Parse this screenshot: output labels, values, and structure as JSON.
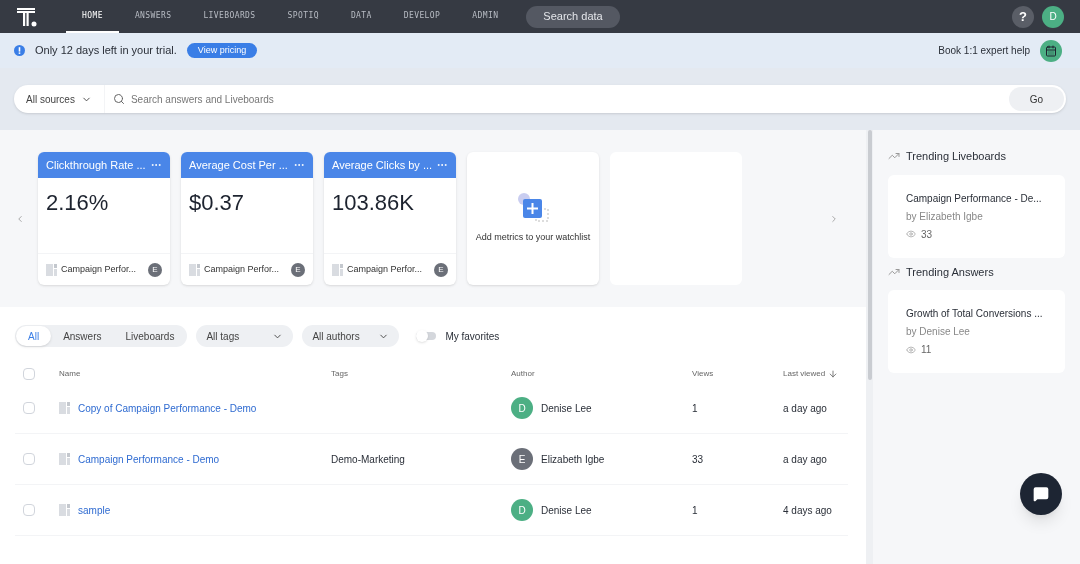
{
  "nav": {
    "items": [
      {
        "label": "HOME",
        "selected": true
      },
      {
        "label": "ANSWERS",
        "selected": false
      },
      {
        "label": "LIVEBOARDS",
        "selected": false
      },
      {
        "label": "SPOTIQ",
        "selected": false
      },
      {
        "label": "DATA",
        "selected": false
      },
      {
        "label": "DEVELOP",
        "selected": false
      },
      {
        "label": "ADMIN",
        "selected": false
      }
    ],
    "search_button": "Search data",
    "help": "?",
    "avatar": "D"
  },
  "banner": {
    "message": "Only 12 days left in your trial.",
    "button": "View pricing",
    "help_text": "Book 1:1 expert help"
  },
  "search": {
    "source": "All sources",
    "placeholder": "Search answers and Liveboards",
    "button": "Go"
  },
  "watchlist": {
    "cards": [
      {
        "kind": "metric",
        "title": "Clickthrough Rate ...",
        "value": "2.16%",
        "source": "Campaign Perfor...",
        "author": "E"
      },
      {
        "kind": "metric",
        "title": "Average Cost Per ...",
        "value": "$0.37",
        "source": "Campaign Perfor...",
        "author": "E"
      },
      {
        "kind": "metric",
        "title": "Average Clicks by ...",
        "value": "103.86K",
        "source": "Campaign Perfor...",
        "author": "E"
      },
      {
        "kind": "add",
        "label": "Add metrics to your watchlist"
      },
      {
        "kind": "empty"
      }
    ]
  },
  "filters": {
    "segments": [
      {
        "label": "All",
        "selected": true
      },
      {
        "label": "Answers",
        "selected": false
      },
      {
        "label": "Liveboards",
        "selected": false
      }
    ],
    "dropdowns": [
      "All tags",
      "All authors"
    ],
    "favorites": {
      "label": "My favorites",
      "on": false
    }
  },
  "table": {
    "select_all_checked": false,
    "columns": [
      "Name",
      "Tags",
      "Author",
      "Views",
      "Last viewed"
    ],
    "rows": [
      {
        "checked": false,
        "name": "Copy of Campaign Performance - Demo",
        "tags": "",
        "author": "Denise Lee",
        "initial": "D",
        "color": "#4caf84",
        "views": "1",
        "last_viewed": "a day ago"
      },
      {
        "checked": false,
        "name": "Campaign Performance - Demo",
        "tags": "Demo-Marketing",
        "author": "Elizabeth Igbe",
        "initial": "E",
        "color": "#6b6f78",
        "views": "33",
        "last_viewed": "a day ago"
      },
      {
        "checked": false,
        "name": "sample",
        "tags": "",
        "author": "Denise Lee",
        "initial": "D",
        "color": "#4caf84",
        "views": "1",
        "last_viewed": "4 days ago"
      }
    ]
  },
  "trending": [
    {
      "heading": "Trending Liveboards",
      "title": "Campaign Performance - De...",
      "by": "by Elizabeth Igbe",
      "views": "33"
    },
    {
      "heading": "Trending Answers",
      "title": "Growth of Total Conversions ...",
      "by": "by Denise Lee",
      "views": "11"
    }
  ]
}
